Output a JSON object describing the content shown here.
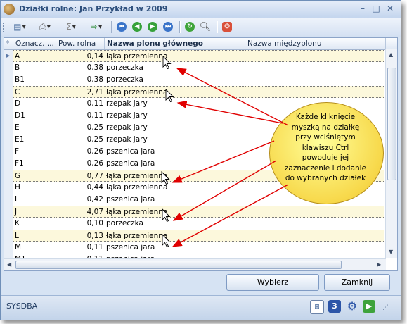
{
  "window": {
    "title": "Działki rolne: Jan Przykład w 2009"
  },
  "columns": [
    "Oznacz. ...",
    "Pow. rolna",
    "Nazwa plonu głównego",
    "Nazwa międzyplonu"
  ],
  "rows": [
    {
      "code": "A",
      "area": "0,14",
      "crop": "łąka przemienna",
      "catch": "",
      "selected": true
    },
    {
      "code": "B",
      "area": "0,38",
      "crop": "porzeczka",
      "catch": "",
      "selected": false
    },
    {
      "code": "B1",
      "area": "0,38",
      "crop": "porzeczka",
      "catch": "",
      "selected": false
    },
    {
      "code": "C",
      "area": "2,71",
      "crop": "łąka przemienna",
      "catch": "",
      "selected": true
    },
    {
      "code": "D",
      "area": "0,11",
      "crop": "rzepak jary",
      "catch": "",
      "selected": false
    },
    {
      "code": "D1",
      "area": "0,11",
      "crop": "rzepak jary",
      "catch": "",
      "selected": false
    },
    {
      "code": "E",
      "area": "0,25",
      "crop": "rzepak jary",
      "catch": "",
      "selected": false
    },
    {
      "code": "E1",
      "area": "0,25",
      "crop": "rzepak jary",
      "catch": "",
      "selected": false
    },
    {
      "code": "F",
      "area": "0,26",
      "crop": "pszenica jara",
      "catch": "",
      "selected": false
    },
    {
      "code": "F1",
      "area": "0,26",
      "crop": "pszenica jara",
      "catch": "",
      "selected": false
    },
    {
      "code": "G",
      "area": "0,77",
      "crop": "łąka przemienna",
      "catch": "",
      "selected": true
    },
    {
      "code": "H",
      "area": "0,44",
      "crop": "łąka przemienna",
      "catch": "",
      "selected": false
    },
    {
      "code": "I",
      "area": "0,42",
      "crop": "pszenica jara",
      "catch": "",
      "selected": false
    },
    {
      "code": "J",
      "area": "4,07",
      "crop": "łąka przemienna",
      "catch": "",
      "selected": true
    },
    {
      "code": "K",
      "area": "0,10",
      "crop": "porzeczka",
      "catch": "",
      "selected": false
    },
    {
      "code": "L",
      "area": "0,13",
      "crop": "łąka przemienna",
      "catch": "",
      "selected": true
    },
    {
      "code": "M",
      "area": "0,11",
      "crop": "pszenica jara",
      "catch": "",
      "selected": false
    },
    {
      "code": "M1",
      "area": "0,11",
      "crop": "pszenica jara",
      "catch": "",
      "selected": false
    }
  ],
  "buttons": {
    "select": "Wybierz",
    "close": "Zamknij"
  },
  "status": {
    "user": "SYSDBA"
  },
  "callout": {
    "text": "Każde kliknięcie myszką na działkę przy wciśniętym klawiszu Ctrl powoduje jej zaznaczenie i dodanie do wybranych działek"
  },
  "colors": {
    "selected_row": "#fcf8dc",
    "callout": "#f7d84a",
    "arrow": "#e00000"
  }
}
